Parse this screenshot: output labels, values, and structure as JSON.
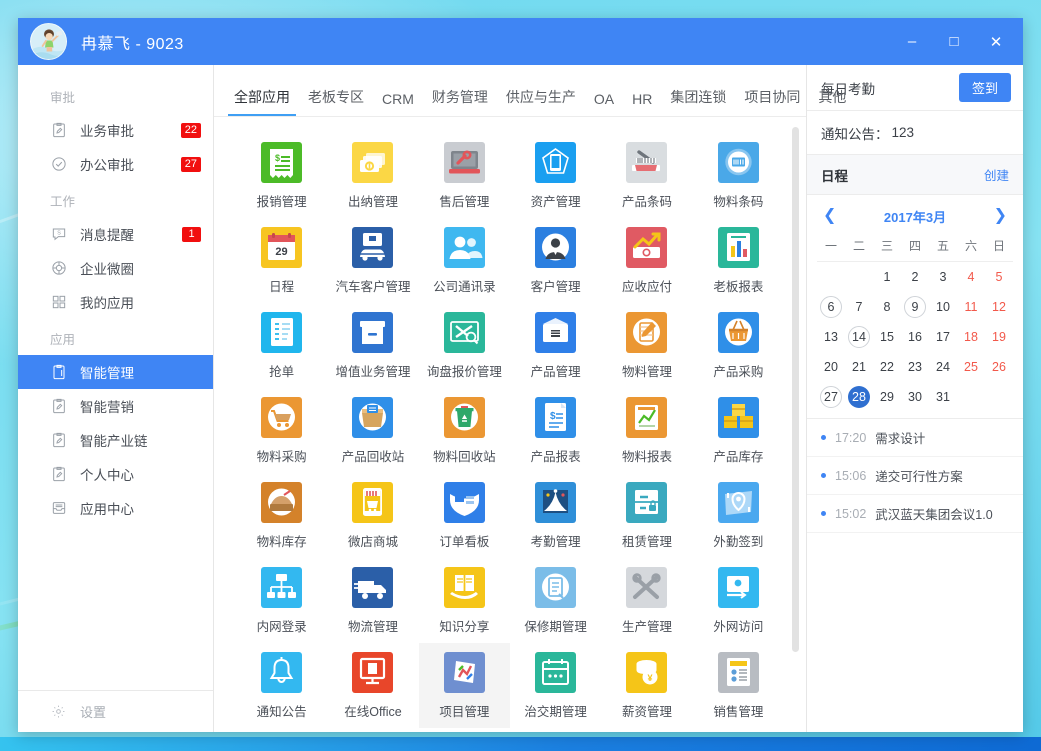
{
  "window": {
    "title": "冉慕飞 - 9023",
    "avatar_icon": "user-photo-avatar",
    "minimize_label": "–",
    "maximize_label": "□",
    "close_label": "✕"
  },
  "sidebar": {
    "sections": [
      {
        "title": "审批",
        "items": [
          {
            "label": "业务审批",
            "icon": "clipboard-pen-icon",
            "badge": "22"
          },
          {
            "label": "办公审批",
            "icon": "check-circle-icon",
            "badge": "27"
          }
        ]
      },
      {
        "title": "工作",
        "items": [
          {
            "label": "消息提醒",
            "icon": "message-bubble-icon",
            "badge": "1"
          },
          {
            "label": "企业微圈",
            "icon": "lifebuoy-icon",
            "badge": ""
          },
          {
            "label": "我的应用",
            "icon": "grid-squares-icon",
            "badge": ""
          }
        ]
      },
      {
        "title": "应用",
        "items": [
          {
            "label": "智能管理",
            "icon": "clipboard-icon",
            "badge": "",
            "active": true
          },
          {
            "label": "智能营销",
            "icon": "clipboard-pen-icon",
            "badge": ""
          },
          {
            "label": "智能产业链",
            "icon": "clipboard-pen-icon",
            "badge": ""
          },
          {
            "label": "个人中心",
            "icon": "clipboard-pen-icon",
            "badge": ""
          },
          {
            "label": "应用中心",
            "icon": "inbox-tray-icon",
            "badge": ""
          }
        ]
      }
    ],
    "footer": {
      "label": "设置",
      "icon": "gear-icon"
    }
  },
  "tabs": [
    {
      "label": "全部应用",
      "active": true
    },
    {
      "label": "老板专区",
      "active": false
    },
    {
      "label": "CRM",
      "active": false
    },
    {
      "label": "财务管理",
      "active": false
    },
    {
      "label": "供应与生产",
      "active": false
    },
    {
      "label": "OA",
      "active": false
    },
    {
      "label": "HR",
      "active": false
    },
    {
      "label": "集团连锁",
      "active": false
    },
    {
      "label": "项目协同",
      "active": false
    },
    {
      "label": "其他",
      "active": false
    }
  ],
  "apps": [
    {
      "label": "报销管理",
      "icon": "receipt-dollar-icon",
      "bg": "#4cbb28",
      "fg": "#ffffff"
    },
    {
      "label": "出纳管理",
      "icon": "cash-stack-icon",
      "bg": "#fbd745",
      "fg": "#ffffff"
    },
    {
      "label": "售后管理",
      "icon": "laptop-wrench-icon",
      "bg": "#c9ccd1",
      "fg": "#ffffff"
    },
    {
      "label": "资产管理",
      "icon": "phone-pentagon-icon",
      "bg": "#1a9ff0",
      "fg": "#ffffff"
    },
    {
      "label": "产品条码",
      "icon": "barcode-scanner-icon",
      "bg": "#d9dde0",
      "fg": "#8a9096"
    },
    {
      "label": "物料条码",
      "icon": "barcode-circle-icon",
      "bg": "#4aa8e8",
      "fg": "#ffffff"
    },
    {
      "label": "日程",
      "icon": "calendar-29-icon",
      "bg": "#f7c521",
      "fg": "#ffffff",
      "day": "29"
    },
    {
      "label": "汽车客户管理",
      "icon": "car-icon",
      "bg": "#2b5fa8",
      "fg": "#ffffff"
    },
    {
      "label": "公司通讯录",
      "icon": "people-icon",
      "bg": "#3fb8f0",
      "fg": "#ffffff"
    },
    {
      "label": "客户管理",
      "icon": "person-tie-icon",
      "bg": "#2b7fe0",
      "fg": "#ffffff"
    },
    {
      "label": "应收应付",
      "icon": "money-chart-up-icon",
      "bg": "#e05a63",
      "fg": "#ffffff"
    },
    {
      "label": "老板报表",
      "icon": "bar-chart-doc-icon",
      "bg": "#2ab79a",
      "fg": "#ffffff"
    },
    {
      "label": "抢单",
      "icon": "order-list-icon",
      "bg": "#20b6ed",
      "fg": "#ffffff"
    },
    {
      "label": "增值业务管理",
      "icon": "archive-box-icon",
      "bg": "#2f74d0",
      "fg": "#ffffff"
    },
    {
      "label": "询盘报价管理",
      "icon": "inquiry-search-icon",
      "bg": "#2ab79a",
      "fg": "#ffffff"
    },
    {
      "label": "产品管理",
      "icon": "package-box-icon",
      "bg": "#2f7fe8",
      "fg": "#ffffff"
    },
    {
      "label": "物料管理",
      "icon": "notebook-pencil-icon",
      "bg": "#eb9733",
      "fg": "#ffffff"
    },
    {
      "label": "产品采购",
      "icon": "shopping-basket-icon",
      "bg": "#2f8fe8",
      "fg": "#ffffff"
    },
    {
      "label": "物料采购",
      "icon": "shopping-cart-icon",
      "bg": "#eb9733",
      "fg": "#ffffff"
    },
    {
      "label": "产品回收站",
      "icon": "recycle-box-icon",
      "bg": "#2f8fe8",
      "fg": "#ffffff"
    },
    {
      "label": "物料回收站",
      "icon": "trash-recycle-icon",
      "bg": "#eb9733",
      "fg": "#ffffff"
    },
    {
      "label": "产品报表",
      "icon": "invoice-doc-icon",
      "bg": "#2f8fe8",
      "fg": "#ffffff"
    },
    {
      "label": "物料报表",
      "icon": "report-chart-icon",
      "bg": "#eb9733",
      "fg": "#ffffff"
    },
    {
      "label": "产品库存",
      "icon": "boxes-stack-icon",
      "bg": "#2f8fe8",
      "fg": "#ffffff"
    },
    {
      "label": "物料库存",
      "icon": "warehouse-bag-icon",
      "bg": "#d4822a",
      "fg": "#ffffff"
    },
    {
      "label": "微店商城",
      "icon": "mobile-shop-icon",
      "bg": "#f5c518",
      "fg": "#ffffff"
    },
    {
      "label": "订单看板",
      "icon": "kanban-board-icon",
      "bg": "#2f7fe8",
      "fg": "#ffffff"
    },
    {
      "label": "考勤管理",
      "icon": "attendance-pin-icon",
      "bg": "#2f8fd8",
      "fg": "#ffffff"
    },
    {
      "label": "租赁管理",
      "icon": "cabinet-lock-icon",
      "bg": "#3aa9bf",
      "fg": "#ffffff"
    },
    {
      "label": "外勤签到",
      "icon": "map-location-icon",
      "bg": "#4aa8ef",
      "fg": "#ffffff"
    },
    {
      "label": "内网登录",
      "icon": "network-tree-icon",
      "bg": "#33b8f0",
      "fg": "#ffffff"
    },
    {
      "label": "物流管理",
      "icon": "delivery-truck-icon",
      "bg": "#2b5fa8",
      "fg": "#ffffff"
    },
    {
      "label": "知识分享",
      "icon": "book-hand-icon",
      "bg": "#f5c518",
      "fg": "#ffffff"
    },
    {
      "label": "保修期管理",
      "icon": "warranty-doc-icon",
      "bg": "#7bbde8",
      "fg": "#ffffff"
    },
    {
      "label": "生产管理",
      "icon": "tools-cross-icon",
      "bg": "#d5d8dc",
      "fg": "#8a9096"
    },
    {
      "label": "外网访问",
      "icon": "remote-access-icon",
      "bg": "#33b8f0",
      "fg": "#ffffff"
    },
    {
      "label": "通知公告",
      "icon": "bell-icon",
      "bg": "#33b8f0",
      "fg": "#ffffff"
    },
    {
      "label": "在线Office",
      "icon": "office-monitor-icon",
      "bg": "#e8462a",
      "fg": "#ffffff"
    },
    {
      "label": "项目管理",
      "icon": "project-chart-icon",
      "bg": "#6f8fd0",
      "fg": "#ffffff",
      "hover": true
    },
    {
      "label": "治交期管理",
      "icon": "calendar-dots-icon",
      "bg": "#2ab79a",
      "fg": "#ffffff"
    },
    {
      "label": "薪资管理",
      "icon": "coins-yuan-icon",
      "bg": "#f5c518",
      "fg": "#ffffff"
    },
    {
      "label": "销售管理",
      "icon": "contact-doc-icon",
      "bg": "#b8bcc2",
      "fg": "#ffffff"
    }
  ],
  "right_panel": {
    "attendance": {
      "title": "每日考勤",
      "signin_label": "签到"
    },
    "notice": {
      "label": "通知公告：",
      "count": "123"
    },
    "schedule_header": {
      "title": "日程",
      "create_label": "创建"
    },
    "calendar": {
      "prev_icon": "chevron-left-icon",
      "next_icon": "chevron-right-icon",
      "month_label": "2017年3月",
      "weekdays": [
        "一",
        "二",
        "三",
        "四",
        "五",
        "六",
        "日"
      ],
      "leading_blanks": 2,
      "days": [
        {
          "d": "1"
        },
        {
          "d": "2"
        },
        {
          "d": "3"
        },
        {
          "d": "4",
          "weekend": true
        },
        {
          "d": "5",
          "weekend": true
        },
        {
          "d": "6",
          "mark": true
        },
        {
          "d": "7"
        },
        {
          "d": "8"
        },
        {
          "d": "9",
          "mark": true
        },
        {
          "d": "10"
        },
        {
          "d": "11",
          "weekend": true
        },
        {
          "d": "12",
          "weekend": true
        },
        {
          "d": "13"
        },
        {
          "d": "14",
          "mark": true
        },
        {
          "d": "15"
        },
        {
          "d": "16"
        },
        {
          "d": "17"
        },
        {
          "d": "18",
          "weekend": true
        },
        {
          "d": "19",
          "weekend": true
        },
        {
          "d": "20"
        },
        {
          "d": "21"
        },
        {
          "d": "22"
        },
        {
          "d": "23"
        },
        {
          "d": "24"
        },
        {
          "d": "25",
          "weekend": true
        },
        {
          "d": "26",
          "weekend": true
        },
        {
          "d": "27",
          "mark": true
        },
        {
          "d": "28",
          "today": true
        },
        {
          "d": "29"
        },
        {
          "d": "30"
        },
        {
          "d": "31"
        }
      ]
    },
    "schedule_items": [
      {
        "time": "17:20",
        "title": "需求设计"
      },
      {
        "time": "15:06",
        "title": "递交可行性方案"
      },
      {
        "time": "15:02",
        "title": "武汉蓝天集团会议1.0"
      }
    ]
  },
  "colors": {
    "accent": "#3f85f4",
    "badge_red": "#f10f0f",
    "tab_underline": "#3f9ff4",
    "weekend_red": "#f2594b",
    "today_blue": "#2f6fd0",
    "desktop": "#77dcf0"
  }
}
